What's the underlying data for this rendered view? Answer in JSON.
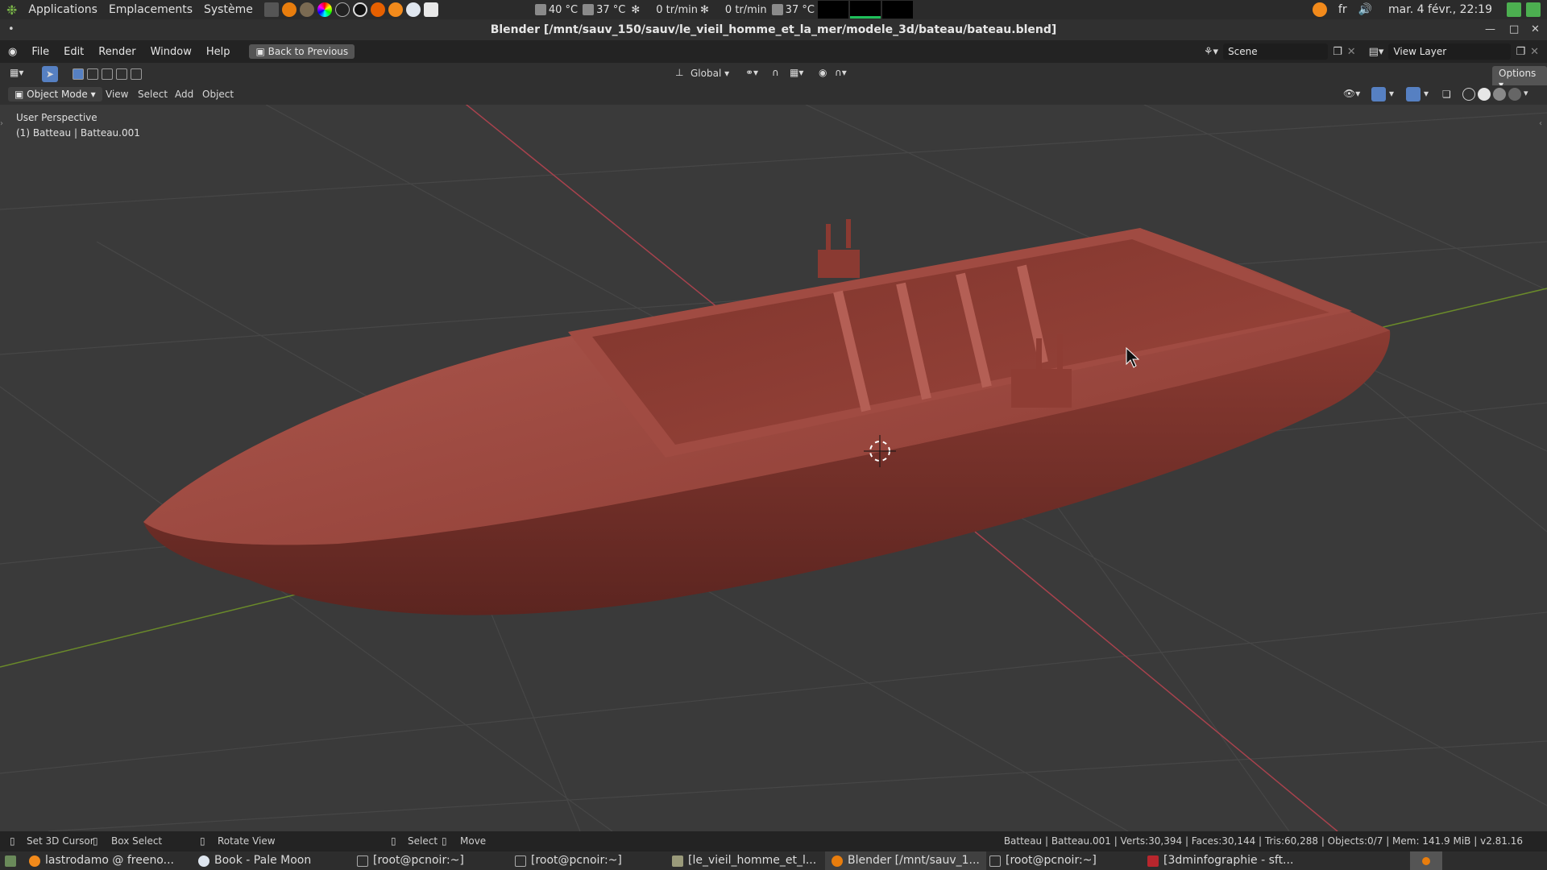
{
  "top_panel": {
    "menus": [
      "Applications",
      "Emplacements",
      "Système"
    ],
    "sensors": [
      "40 °C",
      "37 °C",
      "0 tr/min",
      "0 tr/min",
      "37 °C"
    ],
    "keyboard_layout": "fr",
    "clock": "mar. 4 févr., 22:19"
  },
  "window": {
    "title": "Blender [/mnt/sauv_150/sauv/le_vieil_homme_et_la_mer/modele_3d/bateau/bateau.blend]"
  },
  "blender_header": {
    "menus": [
      "File",
      "Edit",
      "Render",
      "Window",
      "Help"
    ],
    "back_button": "Back to Previous",
    "scene": "Scene",
    "view_layer": "View Layer"
  },
  "tool_header": {
    "orientation": "Global",
    "options": "Options"
  },
  "viewport_header": {
    "mode": "Object Mode",
    "menus": [
      "View",
      "Select",
      "Add",
      "Object"
    ]
  },
  "viewport": {
    "perspective_label": "User Perspective",
    "object_label": "(1) Batteau | Batteau.001",
    "colors": {
      "background": "#3a3a3a",
      "grid": "#4a4a4a",
      "x_axis": "#a8424d",
      "y_axis": "#6a8a2a",
      "boat": "#8e3a31"
    }
  },
  "status_bar": {
    "hints": [
      "Set 3D Cursor",
      "Box Select",
      "Rotate View",
      "Select",
      "Move"
    ],
    "stats": "Batteau | Batteau.001 | Verts:30,394 | Faces:30,144 | Tris:60,288 | Objects:0/7 | Mem: 141.9 MiB | v2.81.16"
  },
  "taskbar": {
    "tasks": [
      "lastrodamo @ freeno...",
      "Book - Pale Moon",
      "[root@pcnoir:~]",
      "[root@pcnoir:~]",
      "[le_vieil_homme_et_l...",
      "Blender [/mnt/sauv_1...",
      "[root@pcnoir:~]",
      "[3dminfographie - sft..."
    ]
  }
}
